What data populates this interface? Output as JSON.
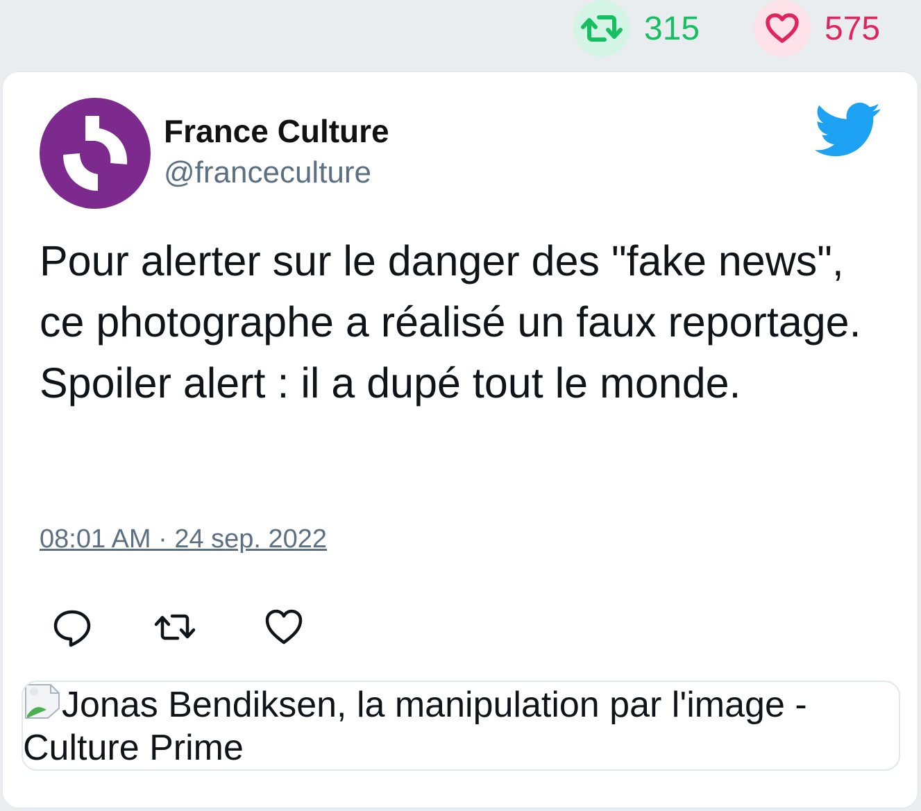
{
  "stats": {
    "retweets": "315",
    "likes": "575"
  },
  "tweet": {
    "author_name": "France Culture",
    "author_handle": "@franceculture",
    "text": "Pour alerter sur le danger des \"fake news\", ce photographe a réalisé un faux reportage. Spoiler alert : il a dupé tout le monde.",
    "timestamp": "08:01 AM · 24 sep. 2022"
  },
  "link_preview": {
    "image_alt": "Jonas Bendiksen, la manipulation par l'image - Culture Prime"
  },
  "icons": {
    "retweet": "retweet-icon",
    "heart": "heart-icon",
    "reply": "reply-icon",
    "twitter": "twitter-bird-icon",
    "broken_image": "broken-image-icon"
  },
  "colors": {
    "retweet": "#17bf63",
    "like": "#e0245e",
    "twitter_blue": "#1da1f2",
    "avatar_purple": "#7d2a8f",
    "muted_text": "#5b7083"
  }
}
